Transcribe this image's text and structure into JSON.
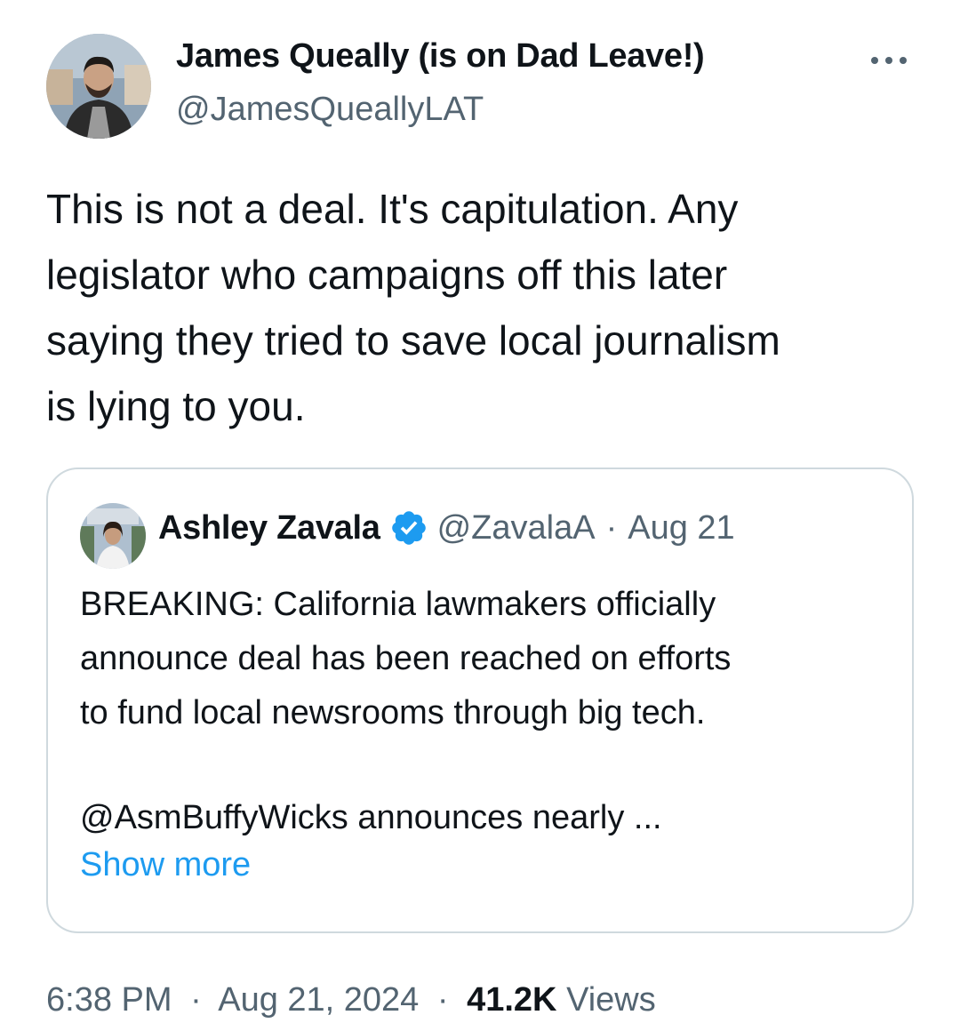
{
  "tweet": {
    "author_name": "James Queally (is on Dad Leave!)",
    "author_handle": "@JamesQueallyLAT",
    "text": "This is not a deal. It's capitulation. Any\nlegislator who campaigns off this later\nsaying they tried to save local journalism\nis lying to you.",
    "more_icon": "ellipsis-icon",
    "time": "6:38 PM",
    "separator": "·",
    "date": "Aug 21, 2024",
    "views_count": "41.2K",
    "views_label": "Views"
  },
  "quote": {
    "author_name": "Ashley Zavala",
    "verified_icon": "verified-badge-icon",
    "author_handle": "@ZavalaA",
    "separator": "·",
    "date": "Aug 21",
    "text": "BREAKING: California lawmakers officially\nannounce deal has been reached on efforts\nto fund local newsrooms through big tech.",
    "text_continued": "@AsmBuffyWicks announces nearly ...",
    "show_more": "Show more"
  },
  "colors": {
    "text": "#0f1419",
    "secondary": "#536471",
    "link": "#1d9bf0",
    "border": "#cfd9de",
    "verified": "#1d9bf0"
  }
}
